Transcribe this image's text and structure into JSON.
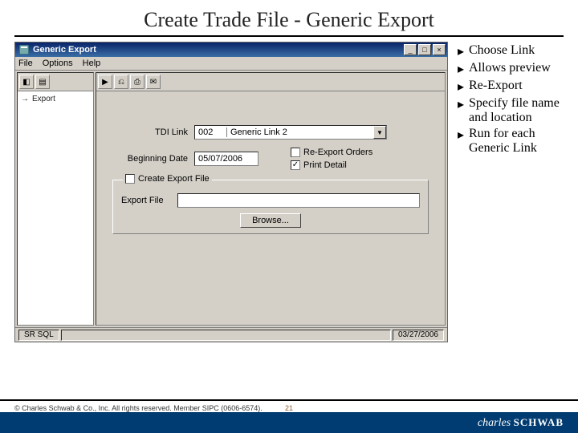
{
  "slide": {
    "title": "Create Trade File - Generic Export",
    "page": "21",
    "copyright": "© Charles Schwab & Co., Inc.  All rights reserved.  Member SIPC (0606-6574).",
    "brand_a": "charles",
    "brand_b": "SCHWAB"
  },
  "bullets": [
    "Choose Link",
    "Allows preview",
    "Re-Export",
    "Specify file name and location",
    "Run for each Generic Link"
  ],
  "window": {
    "title": "Generic Export",
    "menu": {
      "file": "File",
      "options": "Options",
      "help": "Help"
    },
    "left_item": "Export",
    "form": {
      "tdi_label": "TDI Link",
      "tdi_code": "002",
      "tdi_text": "Generic Link 2",
      "date_label": "Beginning Date",
      "date_value": "05/07/2006",
      "reexport_label": "Re-Export Orders",
      "print_label": "Print Detail",
      "create_label": "Create Export File",
      "export_file_label": "Export File",
      "export_file_value": "",
      "browse_label": "Browse..."
    },
    "status": {
      "left": "SR SQL",
      "right": "03/27/2006"
    }
  }
}
